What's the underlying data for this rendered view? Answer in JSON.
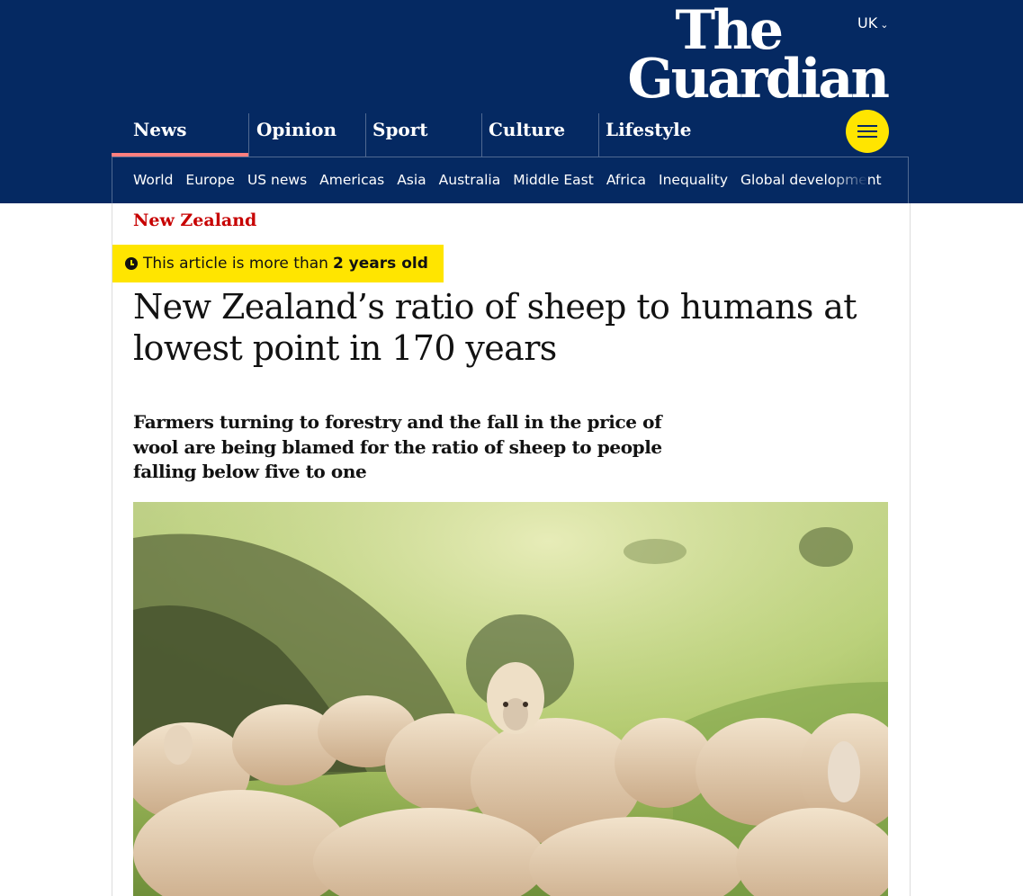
{
  "header": {
    "edition": "UK",
    "logo_line1": "The",
    "logo_line2": "Guardian",
    "pillars": [
      {
        "label": "News",
        "active": true
      },
      {
        "label": "Opinion",
        "active": false
      },
      {
        "label": "Sport",
        "active": false
      },
      {
        "label": "Culture",
        "active": false
      },
      {
        "label": "Lifestyle",
        "active": false
      }
    ],
    "subnav": [
      "World",
      "Europe",
      "US news",
      "Americas",
      "Asia",
      "Australia",
      "Middle East",
      "Africa",
      "Inequality",
      "Global development"
    ]
  },
  "article": {
    "section": "New Zealand",
    "age_warning_prefix": "This article is more than",
    "age_warning_age": "2 years old",
    "headline": "New Zealand’s ratio of sheep to humans at lowest point in 170 years",
    "standfirst": "Farmers turning to forestry and the fall in the price of wool are being blamed for the ratio of sheep to people falling below five to one"
  },
  "colors": {
    "brand_blue": "#052962",
    "news_red": "#c70000",
    "warning_yellow": "#ffe500",
    "pillar_underline": "#ff7f7f"
  },
  "icons": [
    "chevron-down-icon",
    "menu-icon",
    "clock-icon"
  ]
}
